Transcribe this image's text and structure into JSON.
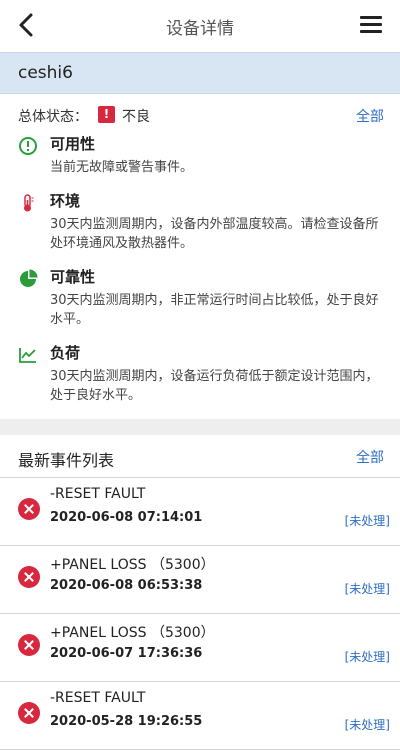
{
  "header": {
    "title": "设备详情"
  },
  "device": {
    "name": "ceshi6"
  },
  "status": {
    "label": "总体状态：",
    "warn_glyph": "!",
    "value": "不良",
    "all_link": "全部"
  },
  "sections": [
    {
      "title": "可用性",
      "text": "当前无故障或警告事件。",
      "icon": "alert-circle-icon",
      "color": "#2a9d3a"
    },
    {
      "title": "环境",
      "text": "30天内监测周期内，设备内外部温度较高。请检查设备所处环境通风及散热器件。",
      "icon": "thermometer-icon",
      "color": "#d8283f"
    },
    {
      "title": "可靠性",
      "text": "30天内监测周期内，非正常运行时间占比较低，处于良好水平。",
      "icon": "pie-chart-icon",
      "color": "#2a9d3a"
    },
    {
      "title": "负荷",
      "text": "30天内监测周期内，设备运行负荷低于额定设计范围内，处于良好水平。",
      "icon": "line-chart-icon",
      "color": "#2a9d3a"
    }
  ],
  "events_header": {
    "title": "最新事件列表",
    "all_link": "全部"
  },
  "events": [
    {
      "name": "-RESET FAULT",
      "time": "2020-06-08 07:14:01",
      "status": "[未处理]"
    },
    {
      "name": "+PANEL LOSS （5300）",
      "time": "2020-06-08 06:53:38",
      "status": "[未处理]"
    },
    {
      "name": "+PANEL LOSS （5300）",
      "time": "2020-06-07 17:36:36",
      "status": "[未处理]"
    },
    {
      "name": "-RESET FAULT",
      "time": "2020-05-28 19:26:55",
      "status": "[未处理]"
    }
  ]
}
